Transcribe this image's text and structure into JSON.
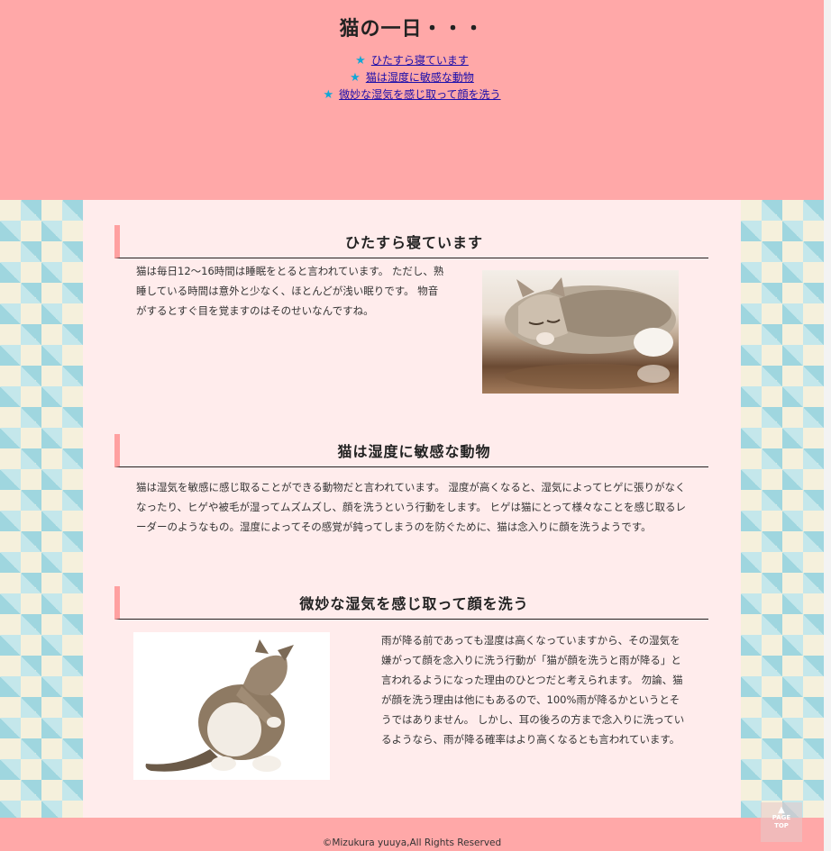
{
  "header": {
    "title": "猫の一日・・・",
    "toc": [
      {
        "label": "ひたすら寝ています"
      },
      {
        "label": "猫は湿度に敏感な動物"
      },
      {
        "label": "微妙な湿気を感じ取って顔を洗う"
      }
    ]
  },
  "sections": [
    {
      "heading": "ひたすら寝ています",
      "text": "猫は毎日12～16時間は睡眠をとると言われています。 ただし、熟睡している時間は意外と少なく、ほとんどが浅い眠りです。 物音がするとすぐ目を覚ますのはそのせいなんですね。"
    },
    {
      "heading": "猫は湿度に敏感な動物",
      "text": "猫は湿気を敏感に感じ取ることができる動物だと言われています。 湿度が高くなると、湿気によってヒゲに張りがなくなったり、ヒゲや被毛が湿ってムズムズし、顔を洗うという行動をします。 ヒゲは猫にとって様々なことを感じ取るレーダーのようなもの。湿度によってその感覚が鈍ってしまうのを防ぐために、猫は念入りに顔を洗うようです。"
    },
    {
      "heading": "微妙な湿気を感じ取って顔を洗う",
      "text": "雨が降る前であっても湿度は高くなっていますから、その湿気を嫌がって顔を念入りに洗う行動が「猫が顔を洗うと雨が降る」と言われるようになった理由のひとつだと考えられます。 勿論、猫が顔を洗う理由は他にもあるので、100%雨が降るかというとそうではありません。 しかし、耳の後ろの方まで念入りに洗っているようなら、雨が降る確率はより高くなるとも言われています。"
    }
  ],
  "footer": {
    "copyright": "©Mizukura yuuya,All Rights Reserved"
  },
  "pagetop": {
    "line1": "PAGE",
    "line2": "TOP"
  },
  "icons": {
    "toc_marker": "star-icon",
    "pagetop": "up-arrow-icon"
  },
  "colors": {
    "header_bg": "#ffa8a8",
    "main_bg": "#ffecec",
    "accent": "#ffa0a0",
    "star": "#11a7d6"
  }
}
